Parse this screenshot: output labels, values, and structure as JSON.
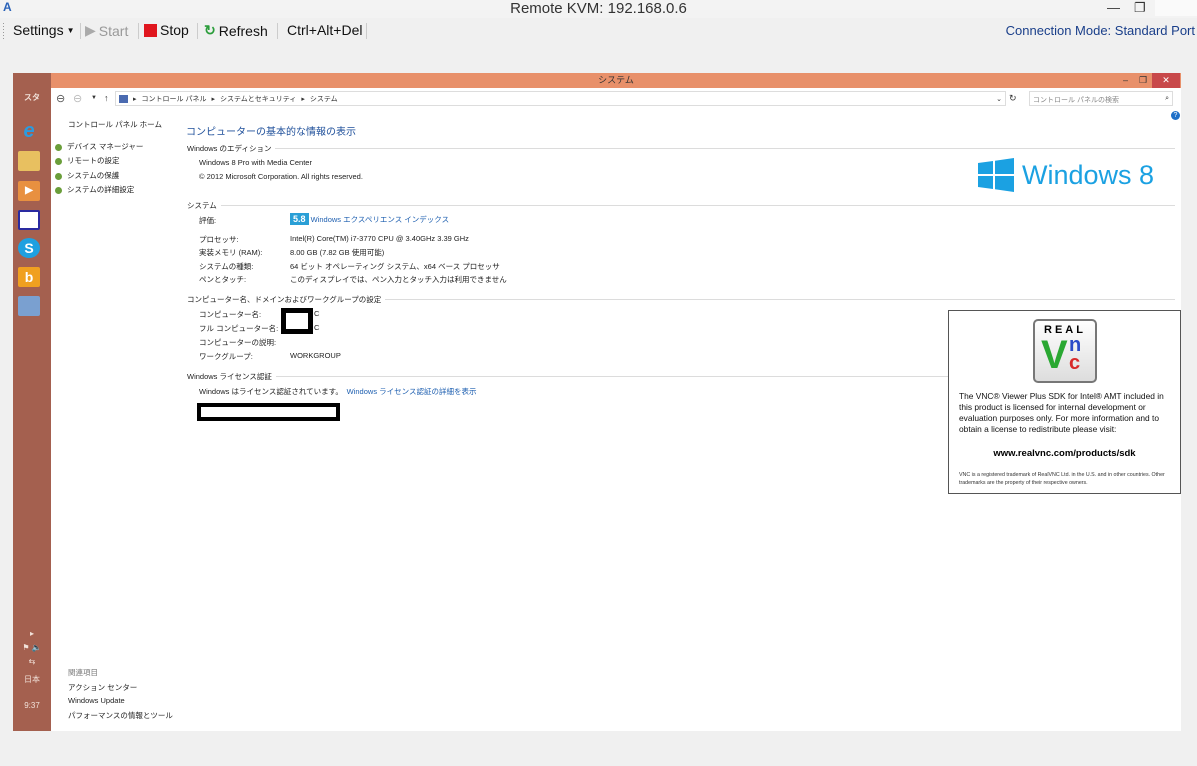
{
  "app": {
    "title": "Remote KVM: 192.168.0.6",
    "connection_mode": "Connection Mode: Standard Port"
  },
  "toolbar": {
    "settings": "Settings",
    "start": "Start",
    "stop": "Stop",
    "refresh": "Refresh",
    "cad": "Ctrl+Alt+Del"
  },
  "taskbar": {
    "start_label": "スタ",
    "lang": "日本",
    "time": "9:37"
  },
  "window": {
    "title": "システム",
    "breadcrumb": [
      "コントロール パネル",
      "システムとセキュリティ",
      "システム"
    ],
    "search_placeholder": "コントロール パネルの検索"
  },
  "sidebar": {
    "home": "コントロール パネル ホーム",
    "items": [
      "デバイス マネージャー",
      "リモートの設定",
      "システムの保護",
      "システムの詳細設定"
    ],
    "related_header": "関連項目",
    "related": [
      "アクション センター",
      "Windows Update",
      "パフォーマンスの情報とツール"
    ]
  },
  "main": {
    "heading": "コンピューターの基本的な情報の表示",
    "edition": {
      "header": "Windows のエディション",
      "name": "Windows 8 Pro with Media Center",
      "copyright": "© 2012 Microsoft Corporation. All rights reserved.",
      "logo": "Windows 8"
    },
    "system": {
      "header": "システム",
      "rating_label": "評価:",
      "rating_score": "5.8",
      "rating_link": "Windows エクスペリエンス インデックス",
      "rows": [
        {
          "label": "プロセッサ:",
          "value": "Intel(R) Core(TM) i7-3770 CPU @ 3.40GHz   3.39 GHz"
        },
        {
          "label": "実装メモリ (RAM):",
          "value": "8.00 GB (7.82 GB 使用可能)"
        },
        {
          "label": "システムの種類:",
          "value": "64 ビット オペレーティング システム、x64 ベース プロセッサ"
        },
        {
          "label": "ペンとタッチ:",
          "value": "このディスプレイでは、ペン入力とタッチ入力は利用できません"
        }
      ]
    },
    "computer": {
      "header": "コンピューター名、ドメインおよびワークグループの設定",
      "rows": [
        {
          "label": "コンピューター名:",
          "value": "C"
        },
        {
          "label": "フル コンピューター名:",
          "value": "C"
        },
        {
          "label": "コンピューターの説明:",
          "value": ""
        },
        {
          "label": "ワークグループ:",
          "value": "WORKGROUP"
        }
      ]
    },
    "license": {
      "header": "Windows ライセンス認証",
      "status": "Windows はライセンス認証されています。",
      "link": "Windows ライセンス認証の詳細を表示"
    }
  },
  "vnc": {
    "logo": "REAL VNC",
    "text": "The VNC® Viewer Plus SDK for Intel® AMT included in this product is licensed for internal development or evaluation purposes only.  For more information and to obtain a license to redistribute please visit:",
    "url": "www.realvnc.com/products/sdk",
    "footer": "VNC is a registered trademark of RealVNC Ltd. in the U.S. and in other countries. Other trademarks are the property of their respective owners."
  }
}
